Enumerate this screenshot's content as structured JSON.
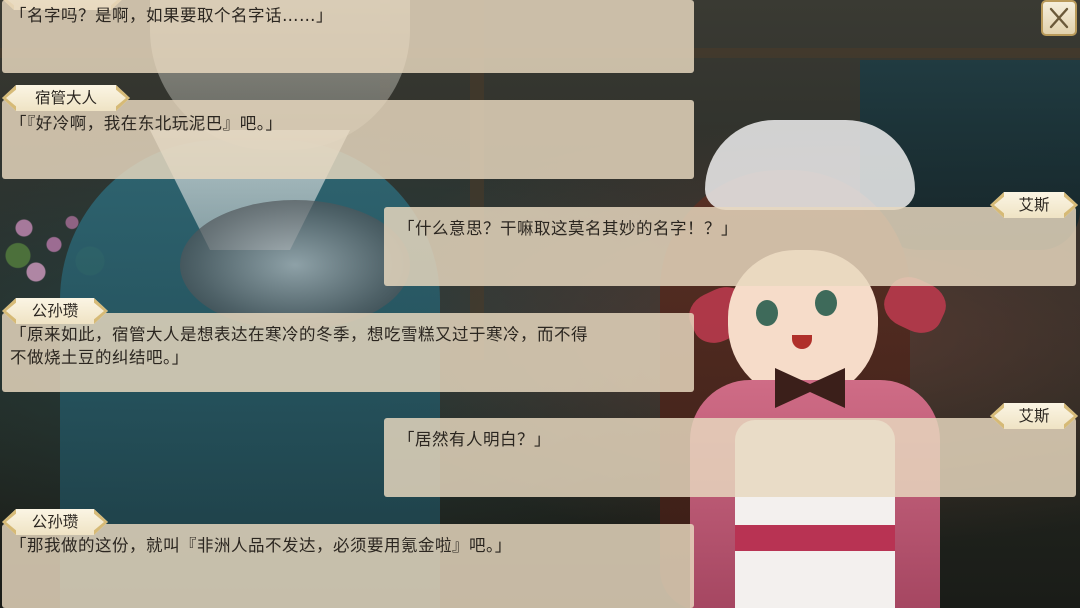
{
  "close_button": {
    "icon": "close-icon"
  },
  "messages": [
    {
      "speaker": "",
      "text": "「名字吗？是啊，如果要取个名字话……」"
    },
    {
      "speaker": "宿管大人",
      "text": "「『好冷啊，我在东北玩泥巴』吧。」"
    },
    {
      "speaker": "艾斯",
      "text": "「什么意思？干嘛取这莫名其妙的名字！？」"
    },
    {
      "speaker": "公孙瓒",
      "text": "「原来如此，宿管大人是想表达在寒冷的冬季，想吃雪糕又过于寒冷，而不得\n不做烧土豆的纠结吧。」"
    },
    {
      "speaker": "艾斯",
      "text": "「居然有人明白？」"
    },
    {
      "speaker": "公孙瓒",
      "text": "「那我做的这份，就叫『非洲人品不发达，必须要用氪金啦』吧。」"
    }
  ]
}
